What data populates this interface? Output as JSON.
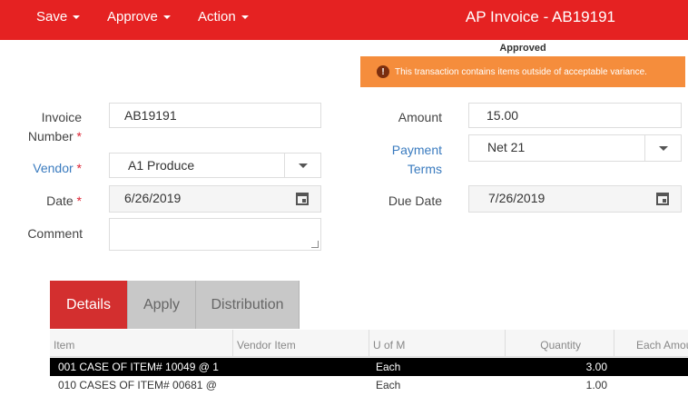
{
  "topbar": {
    "menus": [
      {
        "label": "Save"
      },
      {
        "label": "Approve"
      },
      {
        "label": "Action"
      }
    ],
    "title": "AP Invoice - AB19191"
  },
  "status": "Approved",
  "warning": "This transaction contains items outside of acceptable variance.",
  "form": {
    "invoice_number": {
      "label": "Invoice Number",
      "value": "AB19191"
    },
    "vendor": {
      "label": "Vendor",
      "value": "A1 Produce"
    },
    "date": {
      "label": "Date",
      "value": "6/26/2019"
    },
    "comment": {
      "label": "Comment",
      "value": ""
    },
    "amount": {
      "label": "Amount",
      "value": "15.00"
    },
    "payment_terms": {
      "label1": "Payment",
      "label2": "Terms",
      "value": "Net 21"
    },
    "due_date": {
      "label": "Due Date",
      "value": "7/26/2019"
    },
    "required_mark": "*"
  },
  "tabs": [
    {
      "label": "Details",
      "active": true
    },
    {
      "label": "Apply",
      "active": false
    },
    {
      "label": "Distribution",
      "active": false
    }
  ],
  "grid": {
    "columns": [
      "Item",
      "Vendor Item",
      "U of M",
      "Quantity",
      "Each Amou"
    ],
    "rows": [
      {
        "item": "001 CASE OF ITEM# 10049 @ 1",
        "vendor_item": "",
        "uom": "Each",
        "quantity": "3.00",
        "selected": true
      },
      {
        "item": "010 CASES OF ITEM# 00681 @",
        "vendor_item": "",
        "uom": "Each",
        "quantity": "1.00",
        "selected": false
      }
    ]
  },
  "colors": {
    "brand": "#e52222",
    "tab_active": "#d32f2f",
    "warning": "#f58d3c",
    "link": "#3a7bbf"
  },
  "icons": [
    "dropdown-caret-icon",
    "calendar-icon",
    "warning-icon"
  ]
}
